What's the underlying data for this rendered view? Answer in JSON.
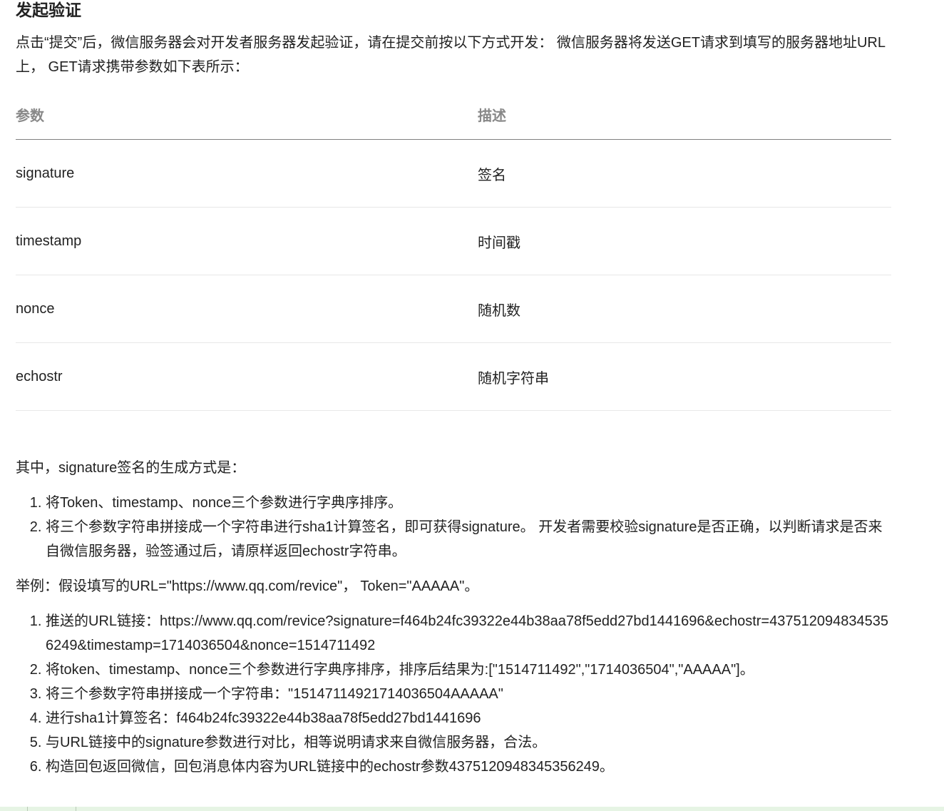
{
  "section_title": "发起验证",
  "intro": "点击“提交”后，微信服务器会对开发者服务器发起验证，请在提交前按以下方式开发： 微信服务器将发送GET请求到填写的服务器地址URL上， GET请求携带参数如下表所示：",
  "table": {
    "headers": [
      "参数",
      "描述"
    ],
    "rows": [
      {
        "param": "signature",
        "desc": "签名"
      },
      {
        "param": "timestamp",
        "desc": "时间戳"
      },
      {
        "param": "nonce",
        "desc": "随机数"
      },
      {
        "param": "echostr",
        "desc": "随机字符串"
      }
    ]
  },
  "signature_intro": "其中，signature签名的生成方式是：",
  "signature_steps": [
    "将Token、timestamp、nonce三个参数进行字典序排序。",
    "将三个参数字符串拼接成一个字符串进行sha1计算签名，即可获得signature。 开发者需要校验signature是否正确，以判断请求是否来自微信服务器，验签通过后，请原样返回echostr字符串。"
  ],
  "example_intro": "举例：假设填写的URL=\"https://www.qq.com/revice\"， Token=\"AAAAA\"。",
  "example_steps": [
    "推送的URL链接：https://www.qq.com/revice?signature=f464b24fc39322e44b38aa78f5edd27bd1441696&echostr=4375120948345356249&timestamp=1714036504&nonce=1514711492",
    "将token、timestamp、nonce三个参数进行字典序排序，排序后结果为:[\"1514711492\",\"1714036504\",\"AAAAA\"]。",
    "将三个参数字符串拼接成一个字符串：\"15147114921714036504AAAAA\"",
    "进行sha1计算签名：f464b24fc39322e44b38aa78f5edd27bd1441696",
    "与URL链接中的signature参数进行对比，相等说明请求来自微信服务器，合法。",
    "构造回包返回微信，回包消息体内容为URL链接中的echostr参数4375120948345356249。"
  ]
}
